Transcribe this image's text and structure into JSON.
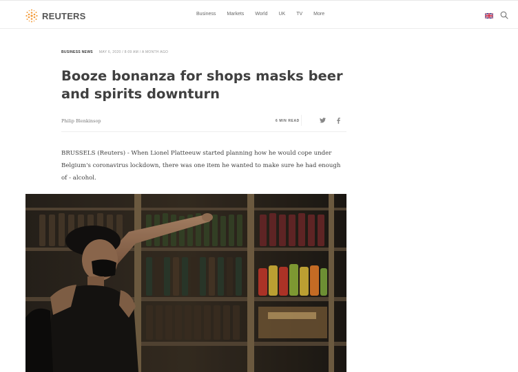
{
  "header": {
    "brand": "REUTERS",
    "nav": [
      "Business",
      "Markets",
      "World",
      "UK",
      "TV",
      "More"
    ],
    "icons": {
      "logo": "reuters-dot-logo-icon",
      "region": "uk-flag-icon",
      "search": "search-icon"
    },
    "colors": {
      "brand_orange": "#f39c3c"
    }
  },
  "article": {
    "section": "BUSINESS NEWS",
    "date": "MAY 6, 2020 / 8:09 AM / A MONTH AGO",
    "headline": "Booze bonanza for shops masks beer and spirits downturn",
    "author": "Philip Blenkinsop",
    "read_time": "6 MIN READ",
    "share": {
      "twitter_icon": "twitter-icon",
      "facebook_icon": "facebook-icon"
    },
    "body": "BRUSSELS (Reuters) - When Lionel Platteeuw started planning how he would cope under Belgium's coronavirus lockdown, there was one item he wanted to make sure he had enough of - alcohol."
  }
}
